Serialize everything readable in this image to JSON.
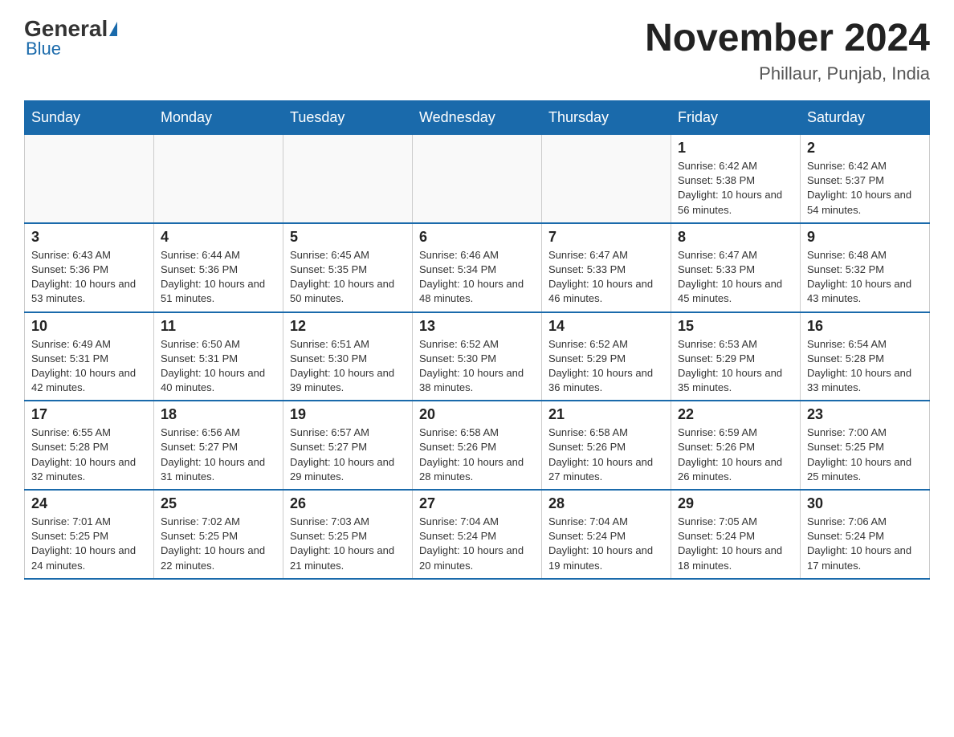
{
  "header": {
    "logo": {
      "general": "General",
      "blue": "Blue"
    },
    "title": "November 2024",
    "subtitle": "Phillaur, Punjab, India"
  },
  "calendar": {
    "days_of_week": [
      "Sunday",
      "Monday",
      "Tuesday",
      "Wednesday",
      "Thursday",
      "Friday",
      "Saturday"
    ],
    "weeks": [
      [
        {
          "day": "",
          "info": ""
        },
        {
          "day": "",
          "info": ""
        },
        {
          "day": "",
          "info": ""
        },
        {
          "day": "",
          "info": ""
        },
        {
          "day": "",
          "info": ""
        },
        {
          "day": "1",
          "info": "Sunrise: 6:42 AM\nSunset: 5:38 PM\nDaylight: 10 hours and 56 minutes."
        },
        {
          "day": "2",
          "info": "Sunrise: 6:42 AM\nSunset: 5:37 PM\nDaylight: 10 hours and 54 minutes."
        }
      ],
      [
        {
          "day": "3",
          "info": "Sunrise: 6:43 AM\nSunset: 5:36 PM\nDaylight: 10 hours and 53 minutes."
        },
        {
          "day": "4",
          "info": "Sunrise: 6:44 AM\nSunset: 5:36 PM\nDaylight: 10 hours and 51 minutes."
        },
        {
          "day": "5",
          "info": "Sunrise: 6:45 AM\nSunset: 5:35 PM\nDaylight: 10 hours and 50 minutes."
        },
        {
          "day": "6",
          "info": "Sunrise: 6:46 AM\nSunset: 5:34 PM\nDaylight: 10 hours and 48 minutes."
        },
        {
          "day": "7",
          "info": "Sunrise: 6:47 AM\nSunset: 5:33 PM\nDaylight: 10 hours and 46 minutes."
        },
        {
          "day": "8",
          "info": "Sunrise: 6:47 AM\nSunset: 5:33 PM\nDaylight: 10 hours and 45 minutes."
        },
        {
          "day": "9",
          "info": "Sunrise: 6:48 AM\nSunset: 5:32 PM\nDaylight: 10 hours and 43 minutes."
        }
      ],
      [
        {
          "day": "10",
          "info": "Sunrise: 6:49 AM\nSunset: 5:31 PM\nDaylight: 10 hours and 42 minutes."
        },
        {
          "day": "11",
          "info": "Sunrise: 6:50 AM\nSunset: 5:31 PM\nDaylight: 10 hours and 40 minutes."
        },
        {
          "day": "12",
          "info": "Sunrise: 6:51 AM\nSunset: 5:30 PM\nDaylight: 10 hours and 39 minutes."
        },
        {
          "day": "13",
          "info": "Sunrise: 6:52 AM\nSunset: 5:30 PM\nDaylight: 10 hours and 38 minutes."
        },
        {
          "day": "14",
          "info": "Sunrise: 6:52 AM\nSunset: 5:29 PM\nDaylight: 10 hours and 36 minutes."
        },
        {
          "day": "15",
          "info": "Sunrise: 6:53 AM\nSunset: 5:29 PM\nDaylight: 10 hours and 35 minutes."
        },
        {
          "day": "16",
          "info": "Sunrise: 6:54 AM\nSunset: 5:28 PM\nDaylight: 10 hours and 33 minutes."
        }
      ],
      [
        {
          "day": "17",
          "info": "Sunrise: 6:55 AM\nSunset: 5:28 PM\nDaylight: 10 hours and 32 minutes."
        },
        {
          "day": "18",
          "info": "Sunrise: 6:56 AM\nSunset: 5:27 PM\nDaylight: 10 hours and 31 minutes."
        },
        {
          "day": "19",
          "info": "Sunrise: 6:57 AM\nSunset: 5:27 PM\nDaylight: 10 hours and 29 minutes."
        },
        {
          "day": "20",
          "info": "Sunrise: 6:58 AM\nSunset: 5:26 PM\nDaylight: 10 hours and 28 minutes."
        },
        {
          "day": "21",
          "info": "Sunrise: 6:58 AM\nSunset: 5:26 PM\nDaylight: 10 hours and 27 minutes."
        },
        {
          "day": "22",
          "info": "Sunrise: 6:59 AM\nSunset: 5:26 PM\nDaylight: 10 hours and 26 minutes."
        },
        {
          "day": "23",
          "info": "Sunrise: 7:00 AM\nSunset: 5:25 PM\nDaylight: 10 hours and 25 minutes."
        }
      ],
      [
        {
          "day": "24",
          "info": "Sunrise: 7:01 AM\nSunset: 5:25 PM\nDaylight: 10 hours and 24 minutes."
        },
        {
          "day": "25",
          "info": "Sunrise: 7:02 AM\nSunset: 5:25 PM\nDaylight: 10 hours and 22 minutes."
        },
        {
          "day": "26",
          "info": "Sunrise: 7:03 AM\nSunset: 5:25 PM\nDaylight: 10 hours and 21 minutes."
        },
        {
          "day": "27",
          "info": "Sunrise: 7:04 AM\nSunset: 5:24 PM\nDaylight: 10 hours and 20 minutes."
        },
        {
          "day": "28",
          "info": "Sunrise: 7:04 AM\nSunset: 5:24 PM\nDaylight: 10 hours and 19 minutes."
        },
        {
          "day": "29",
          "info": "Sunrise: 7:05 AM\nSunset: 5:24 PM\nDaylight: 10 hours and 18 minutes."
        },
        {
          "day": "30",
          "info": "Sunrise: 7:06 AM\nSunset: 5:24 PM\nDaylight: 10 hours and 17 minutes."
        }
      ]
    ]
  }
}
